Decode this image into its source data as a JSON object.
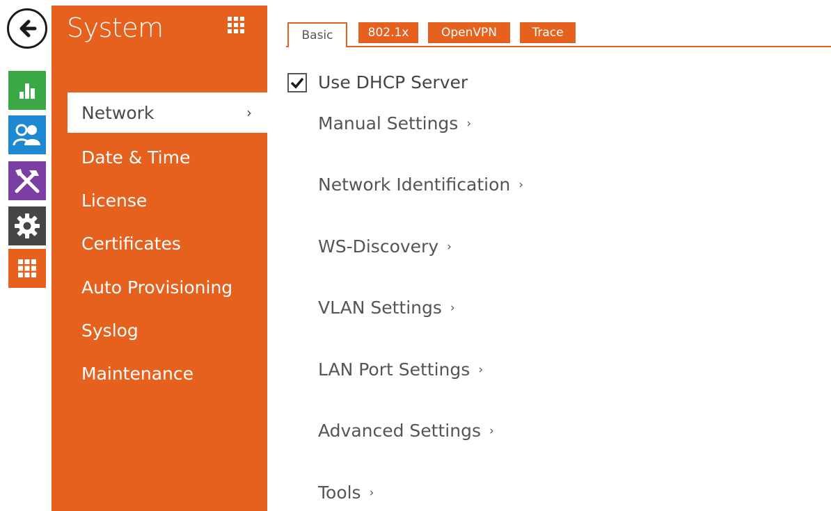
{
  "rail": {
    "items": [
      {
        "name": "status",
        "icon": "bar-chart-icon",
        "color": "#3aa845"
      },
      {
        "name": "users",
        "icon": "users-icon",
        "color": "#1e88d2"
      },
      {
        "name": "services",
        "icon": "tools-icon",
        "color": "#7b3fa4"
      },
      {
        "name": "hardware",
        "icon": "gear-icon",
        "color": "#454545"
      },
      {
        "name": "system",
        "icon": "grid-icon",
        "color": "#e5611d"
      }
    ]
  },
  "section": {
    "title": "System",
    "menu": [
      {
        "label": "Network",
        "chevron": "›",
        "active": true
      },
      {
        "label": "Date & Time"
      },
      {
        "label": "License"
      },
      {
        "label": "Certificates"
      },
      {
        "label": "Auto Provisioning"
      },
      {
        "label": "Syslog"
      },
      {
        "label": "Maintenance"
      }
    ]
  },
  "tabs": [
    {
      "label": "Basic",
      "active": true
    },
    {
      "label": "802.1x"
    },
    {
      "label": "OpenVPN"
    },
    {
      "label": "Trace"
    }
  ],
  "content": {
    "dhcp": {
      "label": "Use DHCP Server",
      "checked": true
    },
    "links": [
      {
        "label": "Manual Settings",
        "chevron": "›"
      },
      {
        "label": "Network Identification",
        "chevron": "›"
      },
      {
        "label": "WS-Discovery",
        "chevron": "›"
      },
      {
        "label": "VLAN Settings",
        "chevron": "›"
      },
      {
        "label": "LAN Port Settings",
        "chevron": "›"
      },
      {
        "label": "Advanced Settings",
        "chevron": "›"
      },
      {
        "label": "Tools",
        "chevron": "›"
      }
    ]
  },
  "colors": {
    "accent": "#e5611d",
    "text": "#4a4a4a"
  }
}
